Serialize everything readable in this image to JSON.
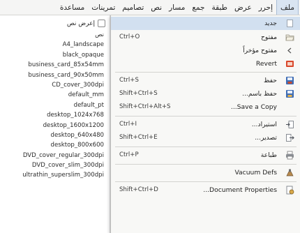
{
  "menubar": {
    "items": [
      {
        "label": "ملف",
        "active": true
      },
      {
        "label": "إحرر"
      },
      {
        "label": "عرض"
      },
      {
        "label": "طبقة"
      },
      {
        "label": "جمع"
      },
      {
        "label": "مسار"
      },
      {
        "label": "نص"
      },
      {
        "label": "تصاميم"
      },
      {
        "label": "تمرينات"
      },
      {
        "label": "مساعدة"
      }
    ]
  },
  "templates": {
    "checkbox_label": "إعرض نص",
    "items": [
      "نص",
      "A4_landscape",
      "black_opaque",
      "business_card_85x54mm",
      "business_card_90x50mm",
      "CD_cover_300dpi",
      "default_mm",
      "default_pt",
      "desktop_1024x768",
      "desktop_1600x1200",
      "desktop_640x480",
      "desktop_800x600",
      "DVD_cover_regular_300dpi",
      "DVD_cover_slim_300dpi",
      "ultrathin_superslim_300dpi"
    ]
  },
  "file_menu": {
    "items": [
      {
        "label": "جديد",
        "shortcut": "",
        "icon": "blank-icon",
        "highlight": true
      },
      {
        "label": "مفتوح",
        "shortcut": "Ctrl+O",
        "icon": "folder-open-icon"
      },
      {
        "label": "مفتوح مؤخراً",
        "shortcut": "",
        "icon": "blank-icon"
      },
      {
        "label": "Revert",
        "shortcut": "",
        "icon": "revert-icon"
      },
      {
        "label": "حفظ",
        "shortcut": "Ctrl+S",
        "icon": "save-icon"
      },
      {
        "label": "حفظ باسم...",
        "shortcut": "Shift+Ctrl+S",
        "icon": "save-as-icon"
      },
      {
        "label": "Save a Copy...",
        "shortcut": "Shift+Ctrl+Alt+S",
        "icon": "blank-icon"
      },
      {
        "label": "استيراد...",
        "shortcut": "Ctrl+I",
        "icon": "import-icon"
      },
      {
        "label": "تصدير...",
        "shortcut": "Shift+Ctrl+E",
        "icon": "export-icon"
      },
      {
        "label": "طباعة",
        "shortcut": "Ctrl+P",
        "icon": "print-icon"
      },
      {
        "label": "Vacuum Defs",
        "shortcut": "",
        "icon": "vacuum-icon"
      },
      {
        "label": "Document Properties...",
        "shortcut": "Shift+Ctrl+D",
        "icon": "document-properties-icon"
      }
    ]
  },
  "colors": {
    "highlight": "#d2e0f0",
    "menubar_bg": "#f5f5f4",
    "dropdown_bg": "#f8f8f6"
  }
}
